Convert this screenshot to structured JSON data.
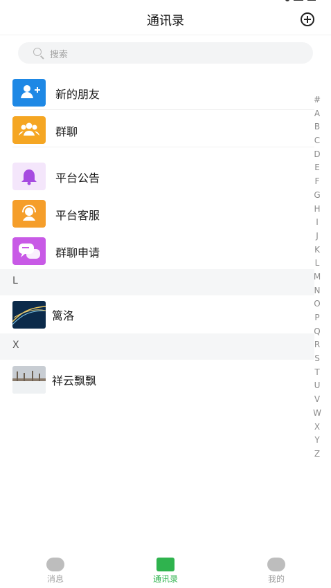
{
  "header": {
    "title": "通讯录"
  },
  "search": {
    "placeholder": "搜索"
  },
  "actions": [
    {
      "label": "新的朋友",
      "icon": "add-user-icon",
      "color": "#1E88E5"
    },
    {
      "label": "群聊",
      "icon": "group-icon",
      "color": "#F5A623"
    },
    {
      "label": "平台公告",
      "icon": "bell-icon",
      "color": "#A64BE0"
    },
    {
      "label": "平台客服",
      "icon": "headset-icon",
      "color": "#F59E2A"
    },
    {
      "label": "群聊申请",
      "icon": "chat-bubbles-icon",
      "color": "#C85AE6"
    }
  ],
  "sections": [
    {
      "letter": "L",
      "contacts": [
        {
          "name": "篱洛"
        }
      ]
    },
    {
      "letter": "X",
      "contacts": [
        {
          "name": "祥云飘飘"
        }
      ]
    }
  ],
  "index_letters": [
    "#",
    "A",
    "B",
    "C",
    "D",
    "E",
    "F",
    "G",
    "H",
    "I",
    "J",
    "K",
    "L",
    "M",
    "N",
    "O",
    "P",
    "Q",
    "R",
    "S",
    "T",
    "U",
    "V",
    "W",
    "X",
    "Y",
    "Z"
  ],
  "tabbar": {
    "items": [
      {
        "label": "消息",
        "icon": "message-icon"
      },
      {
        "label": "通讯录",
        "icon": "contacts-icon",
        "active": true
      },
      {
        "label": "我的",
        "icon": "profile-icon"
      }
    ],
    "active_color": "#2FB34E"
  }
}
